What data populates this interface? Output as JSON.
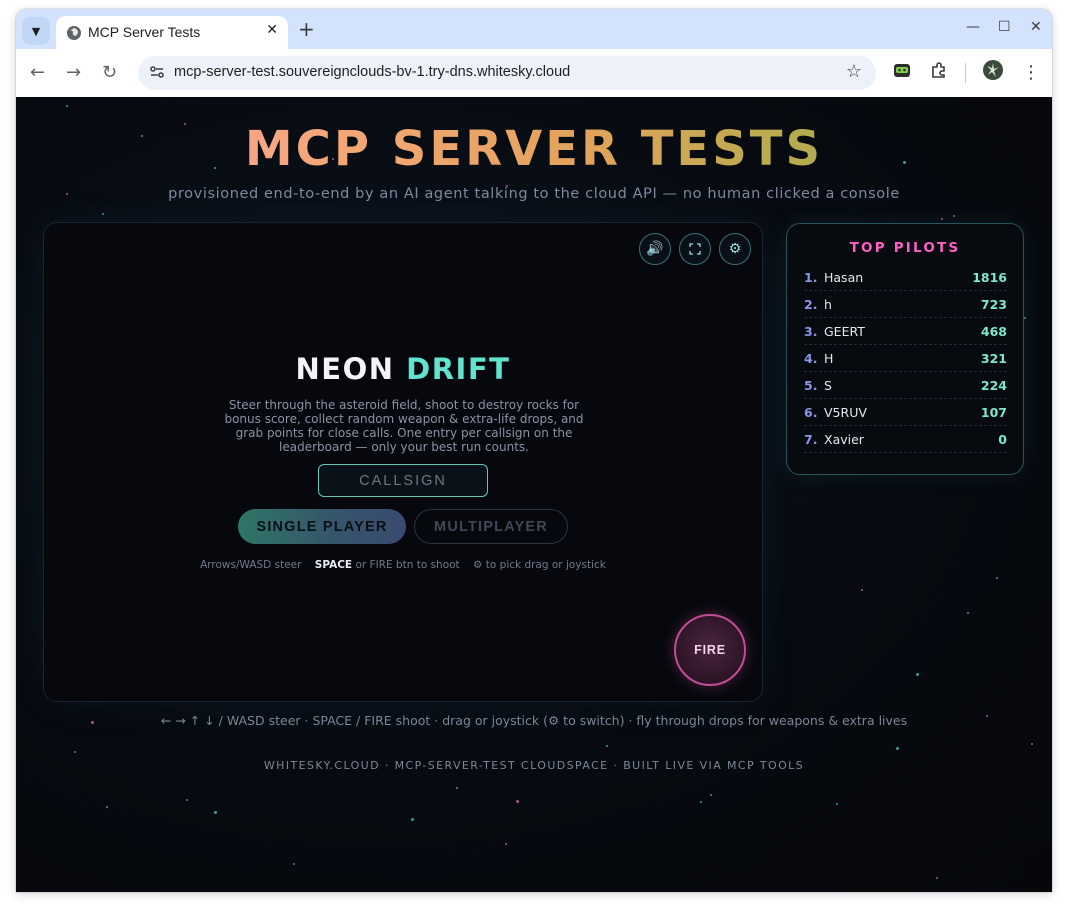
{
  "browser": {
    "tab_title": "MCP Server Tests",
    "tab_close": "✕",
    "new_tab": "+",
    "url": "mcp-server-test.souvereignclouds-bv-1.try-dns.whitesky.cloud",
    "window_controls": {
      "minimize": "—",
      "maximize": "☐",
      "close": "✕"
    },
    "nav": {
      "back": "←",
      "forward": "→",
      "reload": "↻",
      "star": "☆",
      "menu": "⋮"
    }
  },
  "hero": {
    "title": "MCP SERVER TESTS",
    "subtitle": "provisioned end-to-end by an AI agent talking to the cloud API — no human clicked a console"
  },
  "game": {
    "icons": {
      "sound": "🔊",
      "fullscreen": "⛶",
      "settings": "⚙"
    },
    "title_word1": "NEON",
    "title_word2": "DRIFT",
    "description": "Steer through the asteroid field, shoot to destroy rocks for bonus score, collect random weapon & extra-life drops, and grab points for close calls. One entry per callsign on the leaderboard — only your best run counts.",
    "callsign_placeholder": "CALLSIGN",
    "single_player_label": "SINGLE PLAYER",
    "multiplayer_label": "MULTIPLAYER",
    "hint_steer": "Arrows/WASD steer",
    "hint_space": "SPACE",
    "hint_fire": "or FIRE btn to shoot",
    "hint_gear": "⚙ to pick drag or joystick",
    "fire_label": "FIRE"
  },
  "leaderboard": {
    "title": "TOP PILOTS",
    "entries": [
      {
        "rank": "1.",
        "name": "Hasan",
        "score": "1816"
      },
      {
        "rank": "2.",
        "name": "h",
        "score": "723"
      },
      {
        "rank": "3.",
        "name": "GEERT",
        "score": "468"
      },
      {
        "rank": "4.",
        "name": "H",
        "score": "321"
      },
      {
        "rank": "5.",
        "name": "S",
        "score": "224"
      },
      {
        "rank": "6.",
        "name": "V5RUV",
        "score": "107"
      },
      {
        "rank": "7.",
        "name": "Xavier",
        "score": "0"
      }
    ]
  },
  "footer": {
    "hint": "← → ↑ ↓ / WASD steer  ·  SPACE / FIRE shoot  ·  drag or joystick (⚙ to switch)  ·  fly through drops for weapons & extra lives",
    "credit": "WHITESKY.CLOUD · MCP-SERVER-TEST CLOUDSPACE · BUILT LIVE VIA MCP TOOLS"
  },
  "colors": {
    "accent_teal": "#62e3cf",
    "accent_pink": "#ff5fc4",
    "fire_border": "#c24d96",
    "page_bg": "#06080d"
  }
}
